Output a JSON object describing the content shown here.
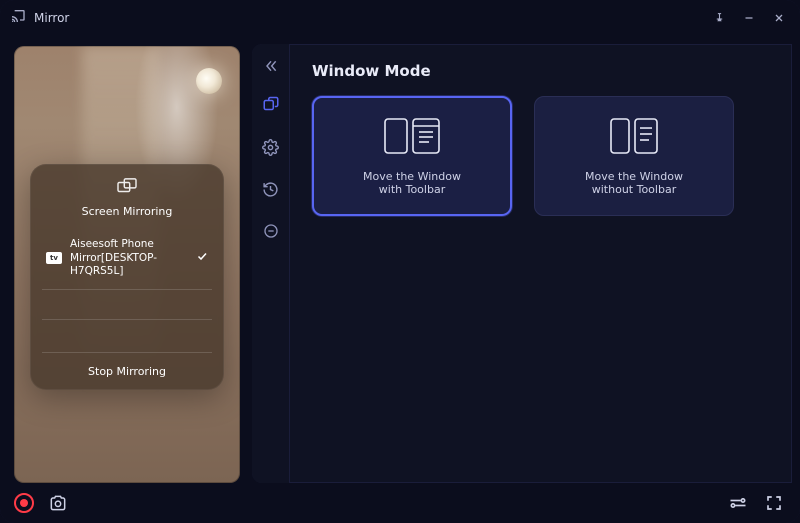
{
  "app": {
    "title": "Mirror"
  },
  "preview": {
    "card_title": "Screen Mirroring",
    "device_name": "Aiseesoft Phone Mirror[DESKTOP-H7QRS5L]",
    "stop_label": "Stop Mirroring"
  },
  "panel": {
    "section_title": "Window Mode",
    "option_a": {
      "line1": "Move the Window",
      "line2": "with Toolbar"
    },
    "option_b": {
      "line1": "Move the Window",
      "line2": "without Toolbar"
    }
  }
}
